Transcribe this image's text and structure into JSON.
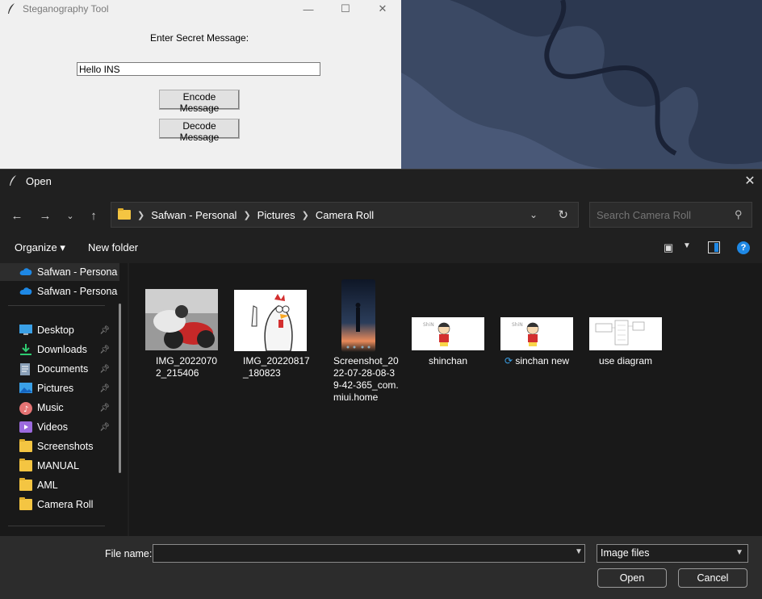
{
  "tk_window": {
    "title": "Steganography Tool",
    "prompt_label": "Enter Secret Message:",
    "message_value": "Hello INS",
    "encode_label": "Encode Message",
    "decode_label": "Decode Message",
    "minimize_glyph": "—",
    "maximize_glyph": "☐",
    "close_glyph": "✕"
  },
  "dialog": {
    "title": "Open",
    "close_glyph": "✕",
    "breadcrumb": [
      "Safwan - Personal",
      "Pictures",
      "Camera Roll"
    ],
    "search_placeholder": "Search Camera Roll",
    "organize_label": "Organize ▾",
    "new_folder_label": "New folder",
    "nav_items": [
      {
        "label": "Safwan - Persona",
        "icon": "onedrive-icon",
        "pinned": false
      },
      {
        "label": "Safwan - Persona",
        "icon": "onedrive-icon",
        "pinned": false
      },
      {
        "label": "Desktop",
        "icon": "desktop-icon",
        "pinned": true
      },
      {
        "label": "Downloads",
        "icon": "downloads-icon",
        "pinned": true
      },
      {
        "label": "Documents",
        "icon": "documents-icon",
        "pinned": true
      },
      {
        "label": "Pictures",
        "icon": "pictures-icon",
        "pinned": true
      },
      {
        "label": "Music",
        "icon": "music-icon",
        "pinned": true
      },
      {
        "label": "Videos",
        "icon": "videos-icon",
        "pinned": true
      },
      {
        "label": "Screenshots",
        "icon": "folder-icon",
        "pinned": false
      },
      {
        "label": "MANUAL",
        "icon": "folder-icon",
        "pinned": false
      },
      {
        "label": "AML",
        "icon": "folder-icon",
        "pinned": false
      },
      {
        "label": "Camera Roll",
        "icon": "folder-icon",
        "pinned": false
      }
    ],
    "files": [
      {
        "name": "IMG_20220702_215406"
      },
      {
        "name": "IMG_20220817_180823"
      },
      {
        "name": "Screenshot_2022-07-28-08-39-42-365_com.miui.home"
      },
      {
        "name": "shinchan"
      },
      {
        "name": "sinchan new",
        "sync_icon": "sync-icon"
      },
      {
        "name": "use diagram"
      }
    ],
    "file_name_label": "File name:",
    "file_name_value": "",
    "file_type": "Image files",
    "open_label": "Open",
    "cancel_label": "Cancel"
  }
}
